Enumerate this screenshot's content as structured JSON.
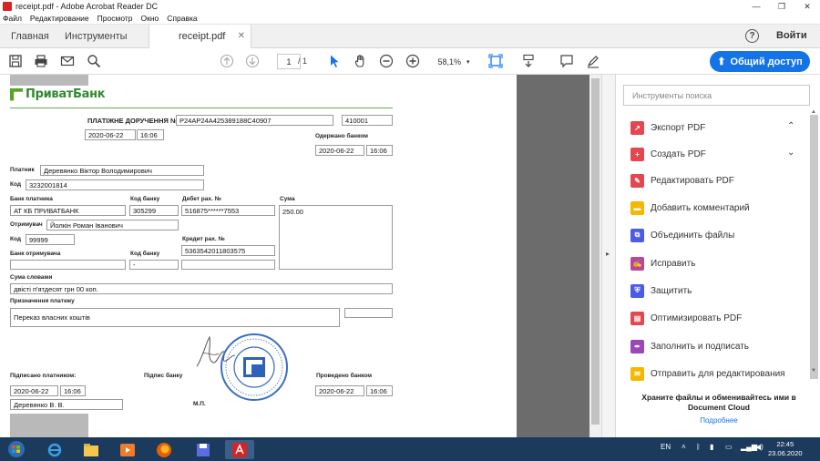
{
  "window": {
    "title": "receipt.pdf - Adobe Acrobat Reader DC",
    "controls": [
      "—",
      "❐",
      "✕"
    ]
  },
  "menu": [
    "Файл",
    "Редактирование",
    "Просмотр",
    "Окно",
    "Справка"
  ],
  "tabs": {
    "home": "Главная",
    "tools": "Инструменты",
    "document": "receipt.pdf",
    "help": "?",
    "login": "Войти"
  },
  "toolbar": {
    "page_current": "1",
    "page_total": "/  1",
    "zoom": "58,1%",
    "share_label": "Общий доступ"
  },
  "receipt": {
    "bank_logo": "ПриватБанк",
    "doc_title": "ПЛАТІЖНЕ ДОРУЧЕННЯ №",
    "doc_number": "P24AP24A425389188C40907",
    "doc_code": "410001",
    "date1": "2020-06-22",
    "time1": "16:06",
    "received_label": "Одержано банком",
    "received_date": "2020-06-22",
    "received_time": "16:06",
    "payer_label": "Платник",
    "payer_name": "Деревянко Віктор Володимирович",
    "code_label": "Код",
    "payer_code": "3232001814",
    "payer_bank_label": "Банк платника",
    "payer_bank": "АТ КБ ПРИВАТБАНК",
    "bank_code_label": "Код банку",
    "bank_code": "305299",
    "debit_label": "Дебет рах. №",
    "debit_acc": "516875******7553",
    "sum_label": "Сума",
    "sum": "250.00",
    "recipient_label": "Отримувач",
    "recipient": "Йолкін Роман Іванович",
    "recipient_code_label": "Код",
    "recipient_code": "99999",
    "credit_label": "Кредит рах. №",
    "credit_acc": "5363542011803575",
    "recipient_bank_label": "Банк отримувача",
    "recipient_bank_code_label": "Код банку",
    "recipient_bank_code": "-",
    "sum_words_label": "Сума словами",
    "sum_words": "двісті п'ятдесят грн 00 коп.",
    "purpose_label": "Призначення платежу",
    "purpose": "Переказ власних коштів",
    "signed_payer_label": "Підписано платником:",
    "bank_sign_label": "Підпис банку",
    "processed_label": "Проведено банком",
    "sign_date": "2020-06-22",
    "sign_time": "16:06",
    "signer": "Деревянко В. В.",
    "mp": "М.П.",
    "processed_date": "2020-06-22",
    "processed_time": "16:06"
  },
  "tools_panel": {
    "search_placeholder": "Инструменты поиска",
    "items": [
      {
        "label": "Экспорт PDF",
        "icon": "export-pdf-icon",
        "color": "#e34850"
      },
      {
        "label": "Создать PDF",
        "icon": "create-pdf-icon",
        "color": "#e34850"
      },
      {
        "label": "Редактировать PDF",
        "icon": "edit-pdf-icon",
        "color": "#e34850"
      },
      {
        "label": "Добавить комментарий",
        "icon": "comment-icon",
        "color": "#f5b800"
      },
      {
        "label": "Объединить файлы",
        "icon": "combine-files-icon",
        "color": "#4b5ce6"
      },
      {
        "label": "Исправить",
        "icon": "fill-sign-icon",
        "color": "#b9469b"
      },
      {
        "label": "Защитить",
        "icon": "protect-icon",
        "color": "#4b5ce6"
      },
      {
        "label": "Оптимизировать PDF",
        "icon": "optimize-pdf-icon",
        "color": "#e34850"
      },
      {
        "label": "Заполнить и подписать",
        "icon": "fill-sign-icon",
        "color": "#9b46b9"
      },
      {
        "label": "Отправить для редактирования",
        "icon": "send-review-icon",
        "color": "#f5b800"
      }
    ],
    "cloud_text": "Храните файлы и обменивайтесь ими в Document Cloud",
    "cloud_link": "Подробнее"
  },
  "taskbar": {
    "lang": "EN",
    "time": "22:45",
    "date": "23.06.2020"
  }
}
